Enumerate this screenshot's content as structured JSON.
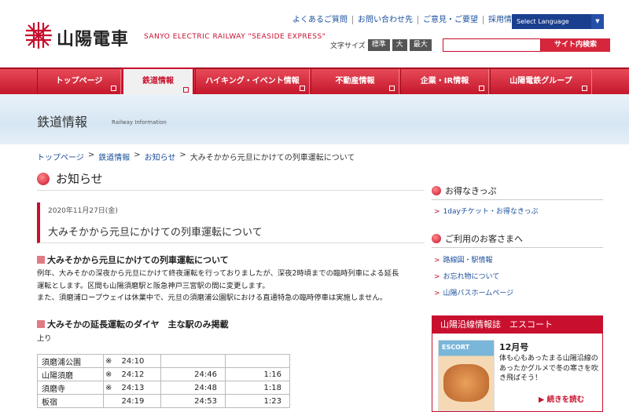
{
  "header": {
    "logo_text": "山陽電車",
    "tagline": "SANYO ELECTRIC RAILWAY \"SEASIDE EXPRESS\"",
    "util_links": [
      "よくあるご質問",
      "お問い合わせ先",
      "ご意見・ご要望",
      "採用情報"
    ],
    "language_select": "Select Language",
    "font_size_label": "文字サイズ",
    "font_size_options": [
      "標準",
      "大",
      "最大"
    ],
    "search_placeholder": "",
    "search_button": "サイト内検索"
  },
  "nav": {
    "items": [
      {
        "label": "トップページ"
      },
      {
        "label": "鉄道情報"
      },
      {
        "label": "ハイキング・イベント情報"
      },
      {
        "label": "不動産情報"
      },
      {
        "label": "企業・IR情報"
      },
      {
        "label": "山陽電鉄グループ"
      }
    ],
    "active_index": 1
  },
  "banner": {
    "title": "鉄道情報",
    "subtitle_en": "Railway Information"
  },
  "breadcrumb": [
    "トップページ",
    "鉄道情報",
    "お知らせ",
    "大みそかから元旦にかけての列車運転について"
  ],
  "main": {
    "heading": "お知らせ",
    "date": "2020年11月27日(金)",
    "article_title": "大みそかから元旦にかけての列車運転について",
    "section1_title": "大みそかから元旦にかけての列車運転について",
    "para1_line1": "例年、大みそかの深夜から元旦にかけて終夜運転を行っておりましたが、深夜2時頃までの臨時列車による延長",
    "para1_line2": "運転とします。区間も山陽須磨駅と阪急神戸三宮駅の間に変更します。",
    "para2": "また、須磨浦ロープウェイは休業中で、元旦の須磨浦公園駅における直通特急の臨時停車は実施しません。",
    "section2_title": "大みそかの延長運転のダイヤ　主な駅のみ掲載",
    "direction": "上り",
    "timetable": [
      [
        "須磨浦公園",
        "※",
        "24:10",
        "",
        ""
      ],
      [
        "山陽須磨",
        "※",
        "24:12",
        "24:46",
        "1:16"
      ],
      [
        "須磨寺",
        "※",
        "24:13",
        "24:48",
        "1:18"
      ],
      [
        "板宿",
        "",
        "24:19",
        "24:53",
        "1:23"
      ]
    ]
  },
  "sidebar": {
    "section1_title": "お得なきっぷ",
    "section1_links": [
      "1dayチケット・お得なきっぷ"
    ],
    "section2_title": "ご利用のお客さまへ",
    "section2_links": [
      "路線図・駅情報",
      "お忘れ物について",
      "山陽バスホームページ"
    ],
    "escort": {
      "bar_title": "山陽沿線情報誌　エスコート",
      "cover_title": "ESCORT",
      "issue": "12月号",
      "text": "体も心もあったまる山陽沿線のあったかグルメで冬の寒さを吹き飛ばそう！",
      "more": "続きを読む"
    }
  },
  "colors": {
    "brand_red": "#c8102e",
    "link_blue": "#1a4f9c",
    "lang_blue": "#1b3f8f"
  }
}
